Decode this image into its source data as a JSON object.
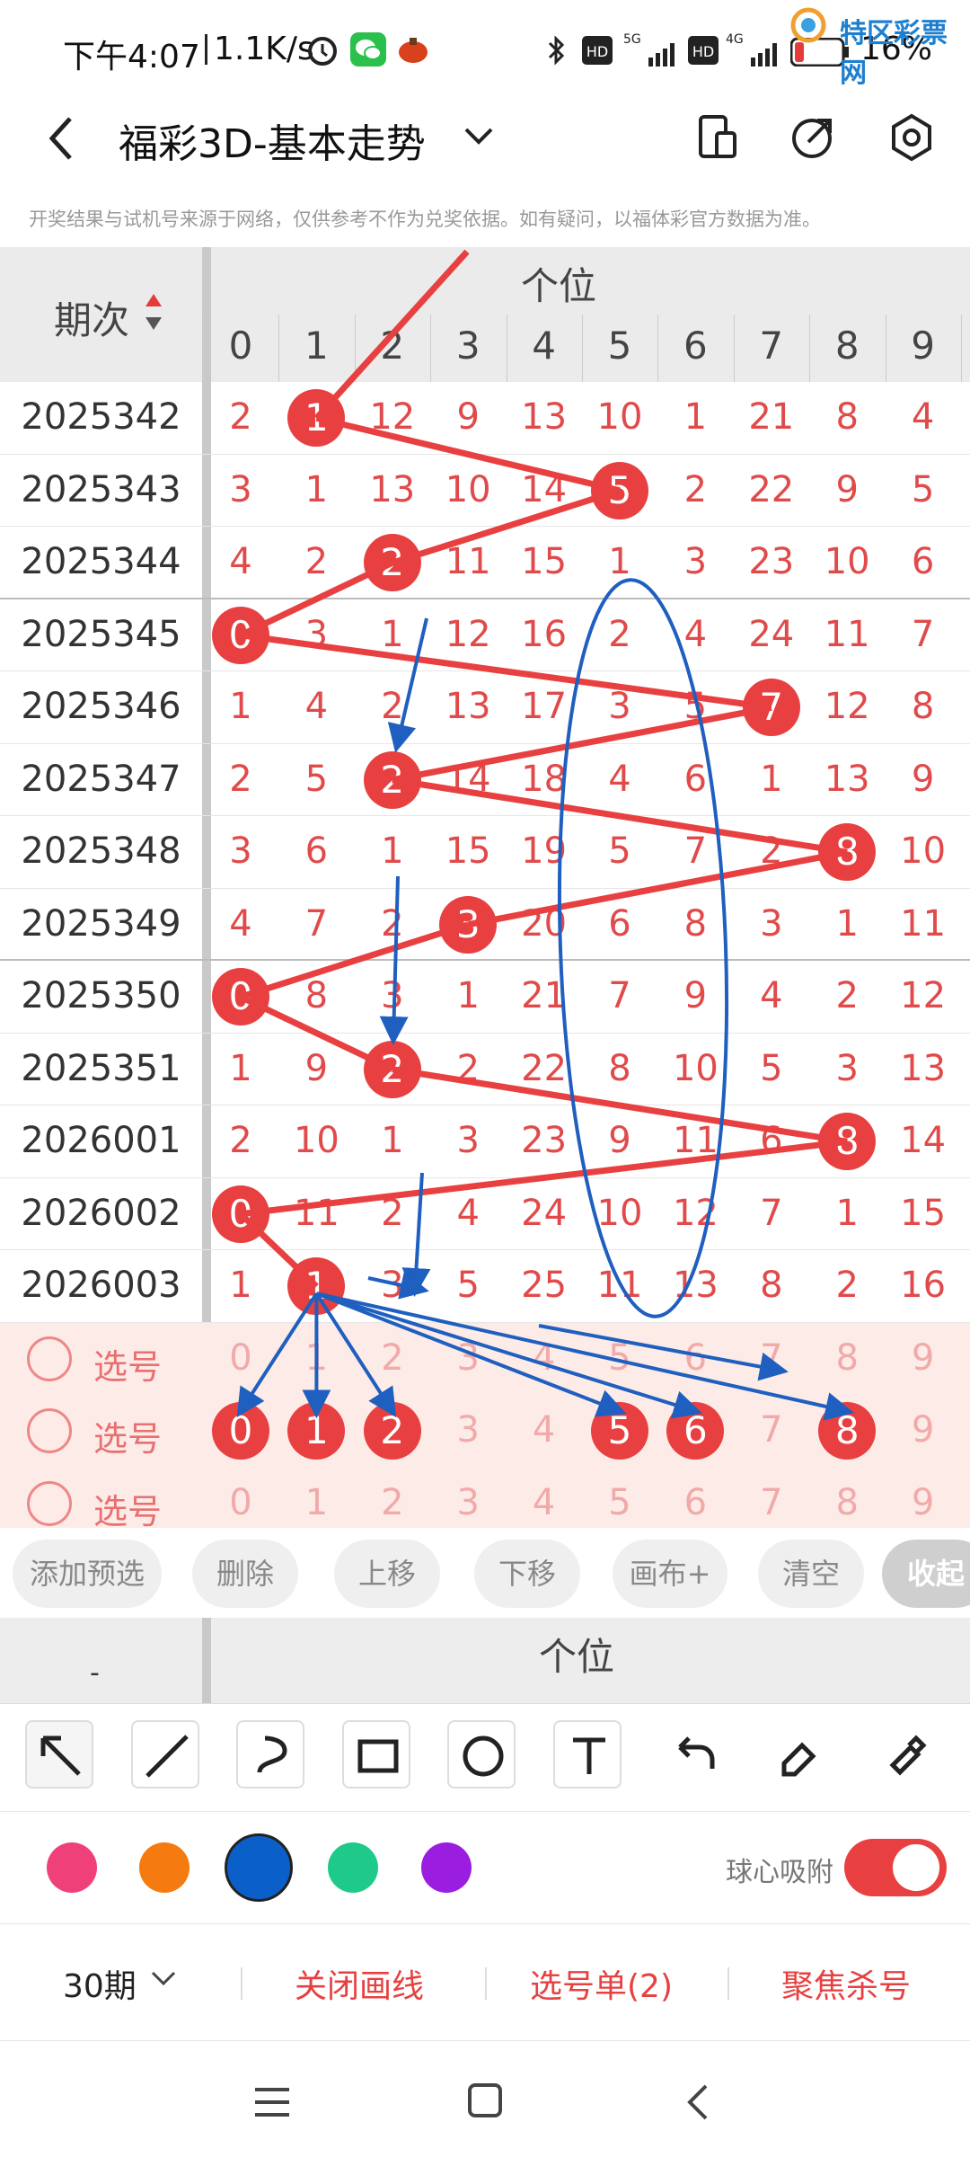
{
  "status_bar": {
    "time": "下午4:07",
    "speed": "1.1K/s",
    "network1": "5G",
    "network2": "4G",
    "battery": "16%",
    "watermark": "特区彩票网"
  },
  "header": {
    "title": "福彩3D-基本走势",
    "notice": "开奖结果与试机号来源于网络，仅供参考不作为兑奖依据。如有疑问，以福体彩官方数据为准。"
  },
  "table": {
    "period_header": "期次",
    "group_header": "个位",
    "digits": [
      "0",
      "1",
      "2",
      "3",
      "4",
      "5",
      "6",
      "7",
      "8",
      "9"
    ],
    "rows": [
      {
        "period": "2025342",
        "cells": [
          "2",
          "1",
          "12",
          "9",
          "13",
          "10",
          "1",
          "21",
          "8",
          "4"
        ],
        "hit": 1
      },
      {
        "period": "2025343",
        "cells": [
          "3",
          "1",
          "13",
          "10",
          "14",
          "5",
          "2",
          "22",
          "9",
          "5"
        ],
        "hit": 5
      },
      {
        "period": "2025344",
        "cells": [
          "4",
          "2",
          "2",
          "11",
          "15",
          "1",
          "3",
          "23",
          "10",
          "6"
        ],
        "hit": 2
      },
      {
        "period": "2025345",
        "cells": [
          "0",
          "3",
          "1",
          "12",
          "16",
          "2",
          "4",
          "24",
          "11",
          "7"
        ],
        "hit": 0
      },
      {
        "period": "2025346",
        "cells": [
          "1",
          "4",
          "2",
          "13",
          "17",
          "3",
          "5",
          "7",
          "12",
          "8"
        ],
        "hit": 7
      },
      {
        "period": "2025347",
        "cells": [
          "2",
          "5",
          "2",
          "14",
          "18",
          "4",
          "6",
          "1",
          "13",
          "9"
        ],
        "hit": 2
      },
      {
        "period": "2025348",
        "cells": [
          "3",
          "6",
          "1",
          "15",
          "19",
          "5",
          "7",
          "2",
          "8",
          "10"
        ],
        "hit": 8
      },
      {
        "period": "2025349",
        "cells": [
          "4",
          "7",
          "2",
          "3",
          "20",
          "6",
          "8",
          "3",
          "1",
          "11"
        ],
        "hit": 3
      },
      {
        "period": "2025350",
        "cells": [
          "0",
          "8",
          "3",
          "1",
          "21",
          "7",
          "9",
          "4",
          "2",
          "12"
        ],
        "hit": 0
      },
      {
        "period": "2025351",
        "cells": [
          "1",
          "9",
          "2",
          "2",
          "22",
          "8",
          "10",
          "5",
          "3",
          "13"
        ],
        "hit": 2
      },
      {
        "period": "2026001",
        "cells": [
          "2",
          "10",
          "1",
          "3",
          "23",
          "9",
          "11",
          "6",
          "8",
          "14"
        ],
        "hit": 8
      },
      {
        "period": "2026002",
        "cells": [
          "0",
          "11",
          "2",
          "4",
          "24",
          "10",
          "12",
          "7",
          "1",
          "15"
        ],
        "hit": 0
      },
      {
        "period": "2026003",
        "cells": [
          "1",
          "1",
          "3",
          "5",
          "25",
          "11",
          "13",
          "8",
          "2",
          "16"
        ],
        "hit": 1
      }
    ],
    "select_label": "选号",
    "select_rows": [
      {
        "cells": [
          "0",
          "1",
          "2",
          "3",
          "4",
          "5",
          "6",
          "7",
          "8",
          "9"
        ],
        "chosen": []
      },
      {
        "cells": [
          "0",
          "1",
          "2",
          "3",
          "4",
          "5",
          "6",
          "7",
          "8",
          "9"
        ],
        "chosen": [
          0,
          1,
          2,
          5,
          6,
          8
        ]
      },
      {
        "cells": [
          "0",
          "1",
          "2",
          "3",
          "4",
          "5",
          "6",
          "7",
          "8",
          "9"
        ],
        "chosen": []
      }
    ]
  },
  "actions": {
    "add": "添加预选",
    "delete": "删除",
    "up": "上移",
    "down": "下移",
    "canvas": "画布+",
    "clear": "清空",
    "collapse": "收起"
  },
  "grid2_header": "个位",
  "grid2_label": "-",
  "tools": [
    "pointer-icon",
    "line-icon",
    "curve-icon",
    "rect-icon",
    "circle-icon",
    "text-icon",
    "undo-icon",
    "eraser-icon",
    "clear-brush-icon"
  ],
  "colors": [
    "#f0407a",
    "#f57a0f",
    "#0b5fc8",
    "#1ec98a",
    "#9b1ee0"
  ],
  "snap_label": "球心吸附",
  "snap_on": true,
  "bottom": {
    "periods": "30期",
    "close_lines": "关闭画线",
    "pick_list": "选号单(2)",
    "focus": "聚焦杀号"
  },
  "accent": "#e84040",
  "draw_blue": "#1f5fbf"
}
